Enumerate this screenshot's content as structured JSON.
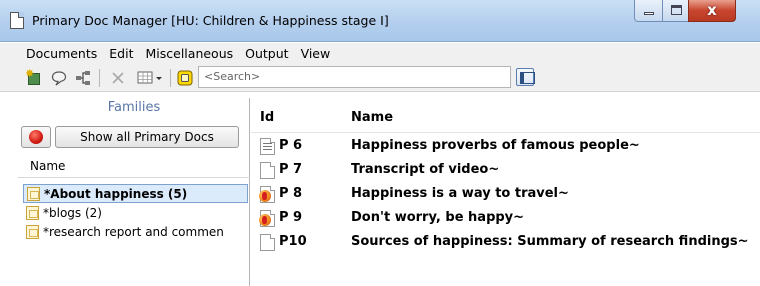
{
  "window": {
    "title": "Primary Doc Manager [HU: Children & Happiness stage I]",
    "close_glyph": "x"
  },
  "menu": [
    "Documents",
    "Edit",
    "Miscellaneous",
    "Output",
    "View"
  ],
  "toolbar": {
    "icons": [
      "new-document-icon",
      "comment-icon",
      "tree-view-icon",
      "delete-icon",
      "grid-view-icon",
      "highlight-icon"
    ],
    "search_placeholder": "<Search>",
    "side_toggle_icon": "side-panel-toggle-icon"
  },
  "families": {
    "title": "Families",
    "show_all_label": "Show all Primary Docs",
    "name_header": "Name",
    "items": [
      {
        "label": "*About happiness (5)",
        "selected": true
      },
      {
        "label": "*blogs (2)",
        "selected": false
      },
      {
        "label": "*research report and commen",
        "selected": false
      }
    ]
  },
  "docs": {
    "columns": {
      "id": "Id",
      "name": "Name"
    },
    "rows": [
      {
        "id": "P 6",
        "name": "Happiness proverbs of famous people~",
        "icon": "text-document-icon"
      },
      {
        "id": "P 7",
        "name": "Transcript of video~",
        "icon": "blank-document-icon"
      },
      {
        "id": "P 8",
        "name": "Happiness is a way to travel~",
        "icon": "media-document-icon"
      },
      {
        "id": "P 9",
        "name": "Don't worry, be happy~",
        "icon": "media-document-icon"
      },
      {
        "id": "P10",
        "name": "Sources of happiness: Summary of research findings~",
        "icon": "blank-document-icon"
      }
    ]
  },
  "colors": {
    "selection_bg": "#dcebfc",
    "families_title": "#5877a6",
    "titlebar": "#b4cfee"
  }
}
